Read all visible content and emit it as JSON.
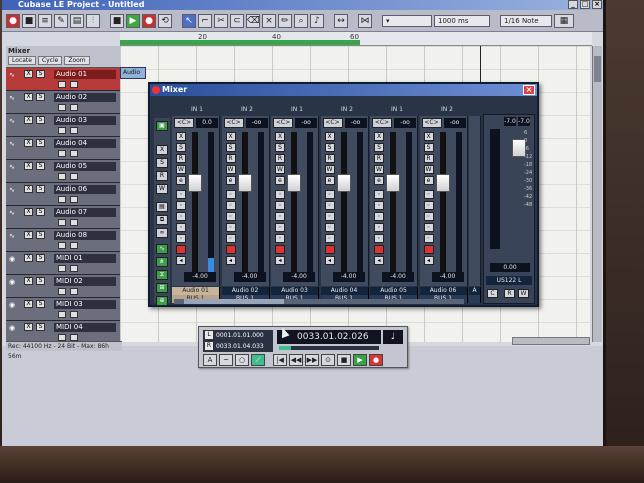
{
  "window": {
    "title": "Cubase LE Project - Untitled",
    "controls": [
      "_",
      "□",
      "×"
    ]
  },
  "toolbar": {
    "zoom_value": "1000 ms",
    "quantize_value": "1/16 Note"
  },
  "ruler": {
    "marks": [
      "20",
      "40",
      "60"
    ],
    "right_locator": "R"
  },
  "tracklist": {
    "mixer_label": "Mixer",
    "buttons": [
      "Locate",
      "Cycle",
      "Zoom"
    ],
    "tracks": [
      {
        "name": "Audio 01",
        "selected": true
      },
      {
        "name": "Audio 02",
        "selected": false
      },
      {
        "name": "Audio 03",
        "selected": false
      },
      {
        "name": "Audio 04",
        "selected": false
      },
      {
        "name": "Audio 05",
        "selected": false
      },
      {
        "name": "Audio 06",
        "selected": false
      },
      {
        "name": "Audio 07",
        "selected": false
      },
      {
        "name": "Audio 08",
        "selected": false
      },
      {
        "name": "MIDI 01",
        "selected": false
      },
      {
        "name": "MIDI 02",
        "selected": false
      },
      {
        "name": "MIDI 03",
        "selected": false
      },
      {
        "name": "MIDI 04",
        "selected": false
      }
    ],
    "mute_label": "X",
    "solo_label": "S",
    "status": "Rec: 44100 Hz - 24 Bit - Max: 86h 56m"
  },
  "arrange": {
    "part_label": "Audio"
  },
  "mixer": {
    "title": "Mixer",
    "close_label": "×",
    "input_labels": [
      "IN 1",
      "IN 2",
      "IN 1",
      "IN 2",
      "IN 1",
      "IN 2"
    ],
    "pan_label": "<C>",
    "channels": [
      {
        "name": "Audio 01",
        "bus": "BUS 1",
        "top_value": "0.0",
        "fader_value": "-4.00",
        "selected": true,
        "level": 0.1
      },
      {
        "name": "Audio 02",
        "bus": "BUS 1",
        "top_value": "-oo",
        "fader_value": "-4.00",
        "selected": false,
        "level": 0
      },
      {
        "name": "Audio 03",
        "bus": "BUS 1",
        "top_value": "-oo",
        "fader_value": "-4.00",
        "selected": false,
        "level": 0
      },
      {
        "name": "Audio 04",
        "bus": "BUS 1",
        "top_value": "-oo",
        "fader_value": "-4.00",
        "selected": false,
        "level": 0
      },
      {
        "name": "Audio 05",
        "bus": "BUS 1",
        "top_value": "-oo",
        "fader_value": "-4.00",
        "selected": false,
        "level": 0
      },
      {
        "name": "Audio 06",
        "bus": "BUS 1",
        "top_value": "-oo",
        "fader_value": "-4.00",
        "selected": false,
        "level": 0
      },
      {
        "name": "A",
        "bus": "BUS 1",
        "top_value": "-oo",
        "fader_value": "",
        "selected": false,
        "level": 0
      }
    ],
    "strip_buttons": [
      "X",
      "S",
      "R",
      "W",
      "e"
    ],
    "master": {
      "left_value": "-7.0",
      "right_value": "-7.0",
      "output_value": "0.00",
      "name": "US122 L",
      "scale": [
        "6",
        "0",
        "-6",
        "-12",
        "-18",
        "-24",
        "-30",
        "-36",
        "-42",
        "-48"
      ],
      "buttons": [
        "C",
        "R",
        "W"
      ]
    },
    "left_buttons": [
      "X",
      "S",
      "R",
      "W",
      "e"
    ]
  },
  "transport": {
    "left_locator": "0001.01.01.000",
    "right_locator": "0033.01.04.033",
    "left_tag": "L",
    "right_tag": "R",
    "position": "0033.01.02.026",
    "note_symbol": "♩",
    "position_fraction": 0.12
  }
}
